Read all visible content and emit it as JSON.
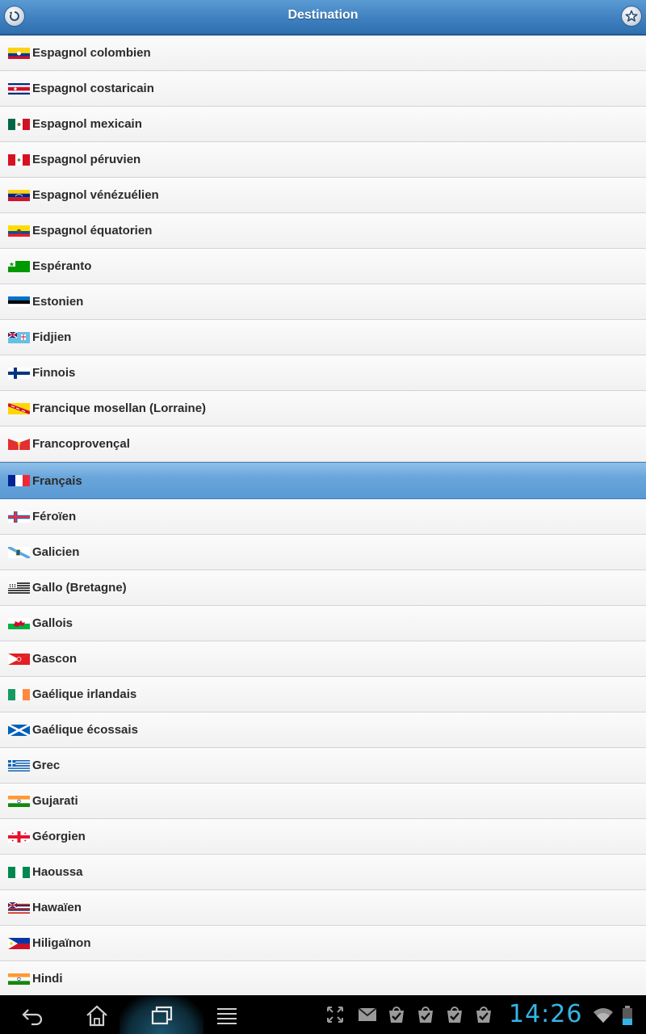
{
  "header": {
    "title": "Destination",
    "back_icon": "back-icon",
    "favorite_icon": "star-icon"
  },
  "languages": [
    {
      "label": "Espagnol colombien",
      "flag": "colombia"
    },
    {
      "label": "Espagnol costaricain",
      "flag": "costa-rica"
    },
    {
      "label": "Espagnol mexicain",
      "flag": "mexico"
    },
    {
      "label": "Espagnol péruvien",
      "flag": "peru"
    },
    {
      "label": "Espagnol vénézuélien",
      "flag": "venezuela"
    },
    {
      "label": "Espagnol équatorien",
      "flag": "ecuador"
    },
    {
      "label": "Espéranto",
      "flag": "esperanto"
    },
    {
      "label": "Estonien",
      "flag": "estonia"
    },
    {
      "label": "Fidjien",
      "flag": "fiji"
    },
    {
      "label": "Finnois",
      "flag": "finland"
    },
    {
      "label": "Francique mosellan (Lorraine)",
      "flag": "lorraine"
    },
    {
      "label": "Francoprovençal",
      "flag": "arpitan"
    },
    {
      "label": "Français",
      "flag": "france",
      "selected": true
    },
    {
      "label": "Féroïen",
      "flag": "faroe"
    },
    {
      "label": "Galicien",
      "flag": "galicia"
    },
    {
      "label": "Gallo (Bretagne)",
      "flag": "brittany"
    },
    {
      "label": "Gallois",
      "flag": "wales"
    },
    {
      "label": "Gascon",
      "flag": "gascony"
    },
    {
      "label": "Gaélique irlandais",
      "flag": "ireland"
    },
    {
      "label": "Gaélique écossais",
      "flag": "scotland"
    },
    {
      "label": "Grec",
      "flag": "greece"
    },
    {
      "label": "Gujarati",
      "flag": "india"
    },
    {
      "label": "Géorgien",
      "flag": "georgia"
    },
    {
      "label": "Haoussa",
      "flag": "nigeria"
    },
    {
      "label": "Hawaïen",
      "flag": "hawaii"
    },
    {
      "label": "Hiligaïnon",
      "flag": "philippines"
    },
    {
      "label": "Hindi",
      "flag": "india"
    }
  ],
  "colors": {
    "header": "#3f80c0",
    "selected_row": "#6aa6dc",
    "clock": "#35b5e5"
  },
  "system_bar": {
    "time": "14:26",
    "nav_icons": [
      "back-nav-icon",
      "home-icon",
      "recent-apps-icon",
      "menu-icon"
    ],
    "notification_icons": [
      "expand-icon",
      "gmail-icon",
      "market-icon",
      "market-icon",
      "market-icon",
      "market-icon"
    ],
    "status_icons": [
      "wifi-icon",
      "battery-icon"
    ]
  }
}
